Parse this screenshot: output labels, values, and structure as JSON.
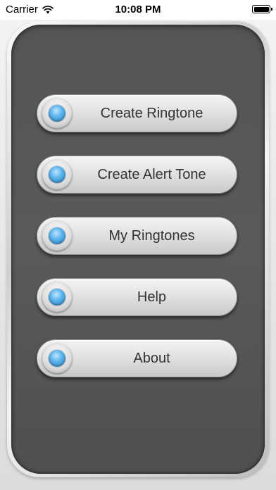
{
  "status_bar": {
    "carrier": "Carrier",
    "time": "10:08 PM",
    "icons": [
      "wifi-icon",
      "battery-icon"
    ]
  },
  "menu": {
    "items": [
      {
        "label": "Create Ringtone",
        "icon": "led-icon"
      },
      {
        "label": "Create Alert Tone",
        "icon": "led-icon"
      },
      {
        "label": "My Ringtones",
        "icon": "led-icon"
      },
      {
        "label": "Help",
        "icon": "led-icon"
      },
      {
        "label": "About",
        "icon": "led-icon"
      }
    ]
  },
  "colors": {
    "panel": "#555555",
    "button_text": "#333333",
    "led_blue": "#4aa6e6"
  }
}
